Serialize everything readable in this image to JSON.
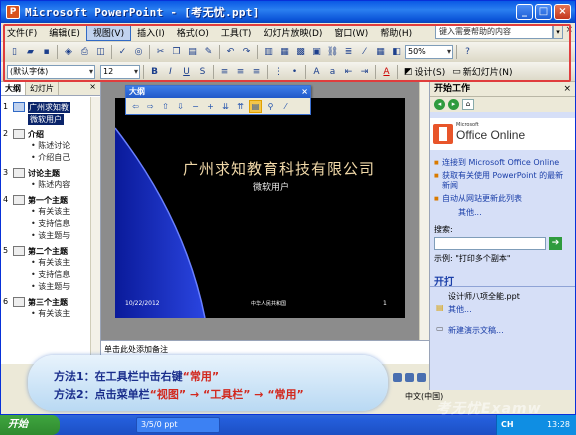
{
  "window": {
    "title": "Microsoft PowerPoint - [考无忧.ppt]",
    "app_icon": "P",
    "controls": [
      "_",
      "□",
      "×"
    ]
  },
  "menubar": {
    "items": [
      "文件(F)",
      "编辑(E)",
      "视图(V)",
      "插入(I)",
      "格式(O)",
      "工具(T)",
      "幻灯片放映(D)",
      "窗口(W)",
      "帮助(H)"
    ],
    "help_placeholder": "键入需要帮助的内容",
    "close": "×"
  },
  "toolbar1": {
    "zoom": "50%"
  },
  "toolbar2": {
    "font_name": "(默认字体)",
    "font_size": "12",
    "bold": "B",
    "italic": "I",
    "underline": "U",
    "shadow": "S",
    "design_label": "设计(S)",
    "new_slide_label": "新幻灯片(N)",
    "font_color": "A"
  },
  "left_pane": {
    "tabs": [
      "大纲",
      "幻灯片"
    ],
    "close": "×",
    "slides": [
      {
        "num": "1",
        "title": "广州求知教",
        "subtitle": "微软用户",
        "bullets": []
      },
      {
        "num": "2",
        "title": "介绍",
        "bullets": [
          "陈述讨论",
          "介绍自己"
        ]
      },
      {
        "num": "3",
        "title": "讨论主题",
        "bullets": [
          "陈述内容"
        ]
      },
      {
        "num": "4",
        "title": "第一个主题",
        "bullets": [
          "有关该主",
          "支持信息",
          "该主题与"
        ]
      },
      {
        "num": "5",
        "title": "第二个主题",
        "bullets": [
          "有关该主",
          "支持信息",
          "该主题与"
        ]
      },
      {
        "num": "6",
        "title": "第三个主题",
        "bullets": [
          "有关该主"
        ]
      }
    ]
  },
  "outline_toolbar": {
    "title": "大纲",
    "close": "×"
  },
  "slide": {
    "title": "广州求知教育科技有限公司",
    "subtitle": "微软用户",
    "date": "10/22/2012",
    "footer": "中华人民共和国",
    "number": "1"
  },
  "notes": {
    "placeholder": "单击此处添加备注"
  },
  "task_pane": {
    "title": "开始工作",
    "close": "×",
    "logo_small": "Microsoft",
    "logo_text": "Office Online",
    "links": [
      "连接到 Microsoft Office Online",
      "获取有关使用 PowerPoint 的最新新闻",
      "自动从网站更新此列表"
    ],
    "more": "其他...",
    "search_label": "搜索:",
    "example": "示例: \"打印多个副本\"",
    "open_section": "开打",
    "recent_file": "设计师八项全能.ppt",
    "open_more": "其他...",
    "new_presentation": "新建演示文稿..."
  },
  "callout": {
    "line1_prefix": "方法1：在工具栏中击右键",
    "line1_keyword": "“常用”",
    "line2_prefix": "方法2：点击菜单栏",
    "line2_keyword": "“视图” → “工具栏” → “常用”"
  },
  "status": {
    "language": "中文(中国)"
  },
  "taskbar": {
    "start": "开始",
    "task_item": "3/5/0 ppt",
    "tray_ch": "CH",
    "clock": "13:28"
  },
  "watermark": "考无忧Examw",
  "colors": {
    "title_bar": "#0a58e5",
    "highlight_frame": "#e03d3d",
    "callout_text": "#1a2e8c",
    "keyword_red": "#d2281e"
  }
}
